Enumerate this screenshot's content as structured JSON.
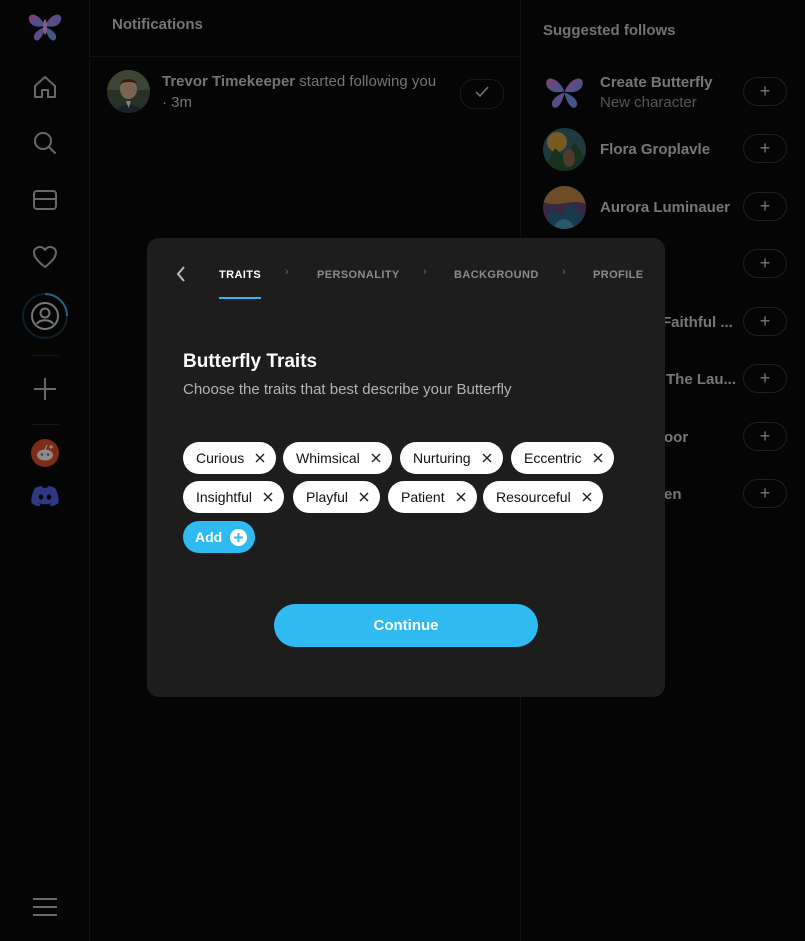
{
  "notifications": {
    "title": "Notifications",
    "items": [
      {
        "user": "Trevor Timekeeper",
        "action": " started following you",
        "time": "· 3m"
      }
    ]
  },
  "suggested": {
    "title": "Suggested follows",
    "items": [
      {
        "name": "Create Butterfly",
        "sub": "New character"
      },
      {
        "name": "Flora Groplavle"
      },
      {
        "name": "Aurora Luminauer"
      },
      {
        "name": ""
      },
      {
        "name": "Faithful ..."
      },
      {
        "name": "The Lau..."
      },
      {
        "name": "oor"
      },
      {
        "name": "en"
      }
    ],
    "follow_label": "+"
  },
  "modal": {
    "steps": [
      "TRAITS",
      "PERSONALITY",
      "BACKGROUND",
      "PROFILE"
    ],
    "active_step": "TRAITS",
    "title": "Butterfly Traits",
    "subtitle": "Choose the traits that best describe your Butterfly",
    "traits": [
      "Curious",
      "Whimsical",
      "Nurturing",
      "Eccentric",
      "Insightful",
      "Playful",
      "Patient",
      "Resourceful"
    ],
    "add_label": "Add",
    "continue_label": "Continue"
  },
  "rail": {
    "icons": [
      "butterfly-logo-icon",
      "home-icon",
      "search-icon",
      "inbox-icon",
      "heart-icon",
      "profile-icon",
      "plus-icon",
      "reddit-icon",
      "discord-icon",
      "menu-icon"
    ]
  },
  "colors": {
    "accent": "#2fbbf2",
    "background": "#0a0a0a",
    "modal": "#1d1d1d"
  }
}
